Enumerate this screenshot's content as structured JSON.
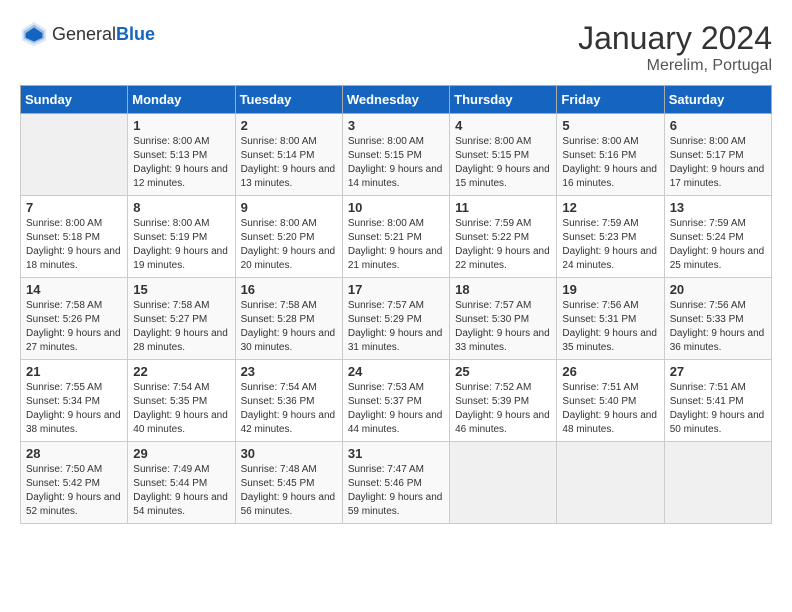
{
  "header": {
    "logo_general": "General",
    "logo_blue": "Blue",
    "month": "January 2024",
    "location": "Merelim, Portugal"
  },
  "weekdays": [
    "Sunday",
    "Monday",
    "Tuesday",
    "Wednesday",
    "Thursday",
    "Friday",
    "Saturday"
  ],
  "weeks": [
    [
      {
        "day": "",
        "sunrise": "",
        "sunset": "",
        "daylight": ""
      },
      {
        "day": "1",
        "sunrise": "Sunrise: 8:00 AM",
        "sunset": "Sunset: 5:13 PM",
        "daylight": "Daylight: 9 hours and 12 minutes."
      },
      {
        "day": "2",
        "sunrise": "Sunrise: 8:00 AM",
        "sunset": "Sunset: 5:14 PM",
        "daylight": "Daylight: 9 hours and 13 minutes."
      },
      {
        "day": "3",
        "sunrise": "Sunrise: 8:00 AM",
        "sunset": "Sunset: 5:15 PM",
        "daylight": "Daylight: 9 hours and 14 minutes."
      },
      {
        "day": "4",
        "sunrise": "Sunrise: 8:00 AM",
        "sunset": "Sunset: 5:15 PM",
        "daylight": "Daylight: 9 hours and 15 minutes."
      },
      {
        "day": "5",
        "sunrise": "Sunrise: 8:00 AM",
        "sunset": "Sunset: 5:16 PM",
        "daylight": "Daylight: 9 hours and 16 minutes."
      },
      {
        "day": "6",
        "sunrise": "Sunrise: 8:00 AM",
        "sunset": "Sunset: 5:17 PM",
        "daylight": "Daylight: 9 hours and 17 minutes."
      }
    ],
    [
      {
        "day": "7",
        "sunrise": "Sunrise: 8:00 AM",
        "sunset": "Sunset: 5:18 PM",
        "daylight": "Daylight: 9 hours and 18 minutes."
      },
      {
        "day": "8",
        "sunrise": "Sunrise: 8:00 AM",
        "sunset": "Sunset: 5:19 PM",
        "daylight": "Daylight: 9 hours and 19 minutes."
      },
      {
        "day": "9",
        "sunrise": "Sunrise: 8:00 AM",
        "sunset": "Sunset: 5:20 PM",
        "daylight": "Daylight: 9 hours and 20 minutes."
      },
      {
        "day": "10",
        "sunrise": "Sunrise: 8:00 AM",
        "sunset": "Sunset: 5:21 PM",
        "daylight": "Daylight: 9 hours and 21 minutes."
      },
      {
        "day": "11",
        "sunrise": "Sunrise: 7:59 AM",
        "sunset": "Sunset: 5:22 PM",
        "daylight": "Daylight: 9 hours and 22 minutes."
      },
      {
        "day": "12",
        "sunrise": "Sunrise: 7:59 AM",
        "sunset": "Sunset: 5:23 PM",
        "daylight": "Daylight: 9 hours and 24 minutes."
      },
      {
        "day": "13",
        "sunrise": "Sunrise: 7:59 AM",
        "sunset": "Sunset: 5:24 PM",
        "daylight": "Daylight: 9 hours and 25 minutes."
      }
    ],
    [
      {
        "day": "14",
        "sunrise": "Sunrise: 7:58 AM",
        "sunset": "Sunset: 5:26 PM",
        "daylight": "Daylight: 9 hours and 27 minutes."
      },
      {
        "day": "15",
        "sunrise": "Sunrise: 7:58 AM",
        "sunset": "Sunset: 5:27 PM",
        "daylight": "Daylight: 9 hours and 28 minutes."
      },
      {
        "day": "16",
        "sunrise": "Sunrise: 7:58 AM",
        "sunset": "Sunset: 5:28 PM",
        "daylight": "Daylight: 9 hours and 30 minutes."
      },
      {
        "day": "17",
        "sunrise": "Sunrise: 7:57 AM",
        "sunset": "Sunset: 5:29 PM",
        "daylight": "Daylight: 9 hours and 31 minutes."
      },
      {
        "day": "18",
        "sunrise": "Sunrise: 7:57 AM",
        "sunset": "Sunset: 5:30 PM",
        "daylight": "Daylight: 9 hours and 33 minutes."
      },
      {
        "day": "19",
        "sunrise": "Sunrise: 7:56 AM",
        "sunset": "Sunset: 5:31 PM",
        "daylight": "Daylight: 9 hours and 35 minutes."
      },
      {
        "day": "20",
        "sunrise": "Sunrise: 7:56 AM",
        "sunset": "Sunset: 5:33 PM",
        "daylight": "Daylight: 9 hours and 36 minutes."
      }
    ],
    [
      {
        "day": "21",
        "sunrise": "Sunrise: 7:55 AM",
        "sunset": "Sunset: 5:34 PM",
        "daylight": "Daylight: 9 hours and 38 minutes."
      },
      {
        "day": "22",
        "sunrise": "Sunrise: 7:54 AM",
        "sunset": "Sunset: 5:35 PM",
        "daylight": "Daylight: 9 hours and 40 minutes."
      },
      {
        "day": "23",
        "sunrise": "Sunrise: 7:54 AM",
        "sunset": "Sunset: 5:36 PM",
        "daylight": "Daylight: 9 hours and 42 minutes."
      },
      {
        "day": "24",
        "sunrise": "Sunrise: 7:53 AM",
        "sunset": "Sunset: 5:37 PM",
        "daylight": "Daylight: 9 hours and 44 minutes."
      },
      {
        "day": "25",
        "sunrise": "Sunrise: 7:52 AM",
        "sunset": "Sunset: 5:39 PM",
        "daylight": "Daylight: 9 hours and 46 minutes."
      },
      {
        "day": "26",
        "sunrise": "Sunrise: 7:51 AM",
        "sunset": "Sunset: 5:40 PM",
        "daylight": "Daylight: 9 hours and 48 minutes."
      },
      {
        "day": "27",
        "sunrise": "Sunrise: 7:51 AM",
        "sunset": "Sunset: 5:41 PM",
        "daylight": "Daylight: 9 hours and 50 minutes."
      }
    ],
    [
      {
        "day": "28",
        "sunrise": "Sunrise: 7:50 AM",
        "sunset": "Sunset: 5:42 PM",
        "daylight": "Daylight: 9 hours and 52 minutes."
      },
      {
        "day": "29",
        "sunrise": "Sunrise: 7:49 AM",
        "sunset": "Sunset: 5:44 PM",
        "daylight": "Daylight: 9 hours and 54 minutes."
      },
      {
        "day": "30",
        "sunrise": "Sunrise: 7:48 AM",
        "sunset": "Sunset: 5:45 PM",
        "daylight": "Daylight: 9 hours and 56 minutes."
      },
      {
        "day": "31",
        "sunrise": "Sunrise: 7:47 AM",
        "sunset": "Sunset: 5:46 PM",
        "daylight": "Daylight: 9 hours and 59 minutes."
      },
      {
        "day": "",
        "sunrise": "",
        "sunset": "",
        "daylight": ""
      },
      {
        "day": "",
        "sunrise": "",
        "sunset": "",
        "daylight": ""
      },
      {
        "day": "",
        "sunrise": "",
        "sunset": "",
        "daylight": ""
      }
    ]
  ]
}
